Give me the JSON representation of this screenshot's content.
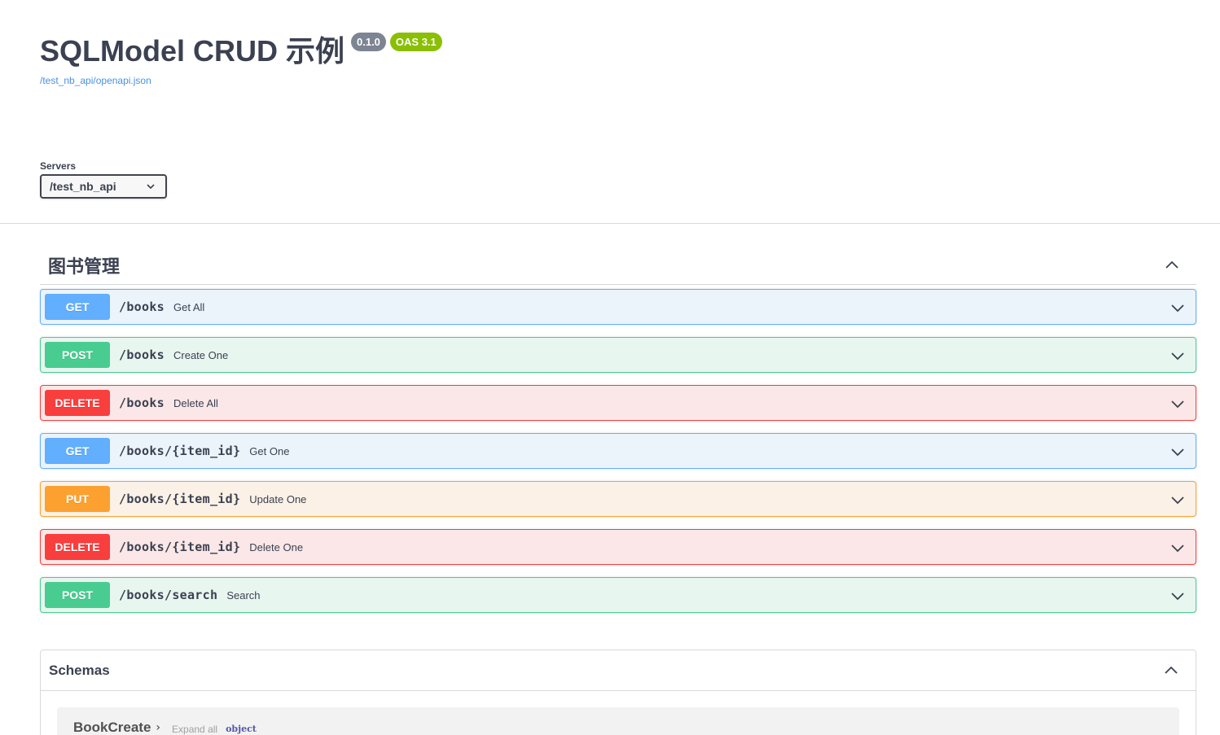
{
  "info": {
    "title": "SQLModel CRUD 示例",
    "version": "0.1.0",
    "oas": "OAS 3.1",
    "openapi_url": "/test_nb_api/openapi.json"
  },
  "servers": {
    "label": "Servers",
    "selected": "/test_nb_api"
  },
  "tag": {
    "name": "图书管理",
    "expanded": true
  },
  "operations": [
    {
      "method": "GET",
      "path": "/books",
      "summary": "Get All"
    },
    {
      "method": "POST",
      "path": "/books",
      "summary": "Create One"
    },
    {
      "method": "DELETE",
      "path": "/books",
      "summary": "Delete All"
    },
    {
      "method": "GET",
      "path": "/books/{item_id}",
      "summary": "Get One"
    },
    {
      "method": "PUT",
      "path": "/books/{item_id}",
      "summary": "Update One"
    },
    {
      "method": "DELETE",
      "path": "/books/{item_id}",
      "summary": "Delete One"
    },
    {
      "method": "POST",
      "path": "/books/search",
      "summary": "Search"
    }
  ],
  "schemas": {
    "title": "Schemas",
    "models": [
      {
        "name": "BookCreate",
        "expand_label": "Expand all",
        "type": "object"
      }
    ]
  },
  "colors": {
    "get": "#61affe",
    "post": "#49cc90",
    "delete": "#f93e3e",
    "put": "#fca130"
  }
}
